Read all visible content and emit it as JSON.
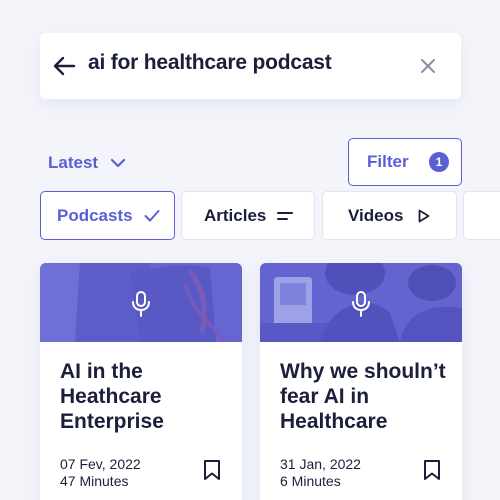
{
  "search": {
    "query": "ai for healthcare podcast",
    "back_icon": "arrow-left-icon",
    "clear_icon": "close-icon"
  },
  "sort": {
    "label": "Latest",
    "icon": "chevron-down-icon"
  },
  "filter": {
    "label": "Filter",
    "count": "1"
  },
  "chips": [
    {
      "label": "Podcasts",
      "icon": "check-icon",
      "active": true
    },
    {
      "label": "Articles",
      "icon": "lines-icon",
      "active": false
    },
    {
      "label": "Videos",
      "icon": "play-icon",
      "active": false
    }
  ],
  "cards": [
    {
      "title": "AI in the Heathcare Enterprise",
      "date": "07 Fev, 2022",
      "duration": "47 Minutes",
      "icon": "microphone-icon"
    },
    {
      "title": "Why we shouln’t fear AI in Healthcare",
      "date": "31 Jan, 2022",
      "duration": "6 Minutes",
      "icon": "microphone-icon"
    }
  ],
  "colors": {
    "accent": "#5a5fd6",
    "text": "#1b1f3b",
    "background": "#f4f5fb"
  }
}
